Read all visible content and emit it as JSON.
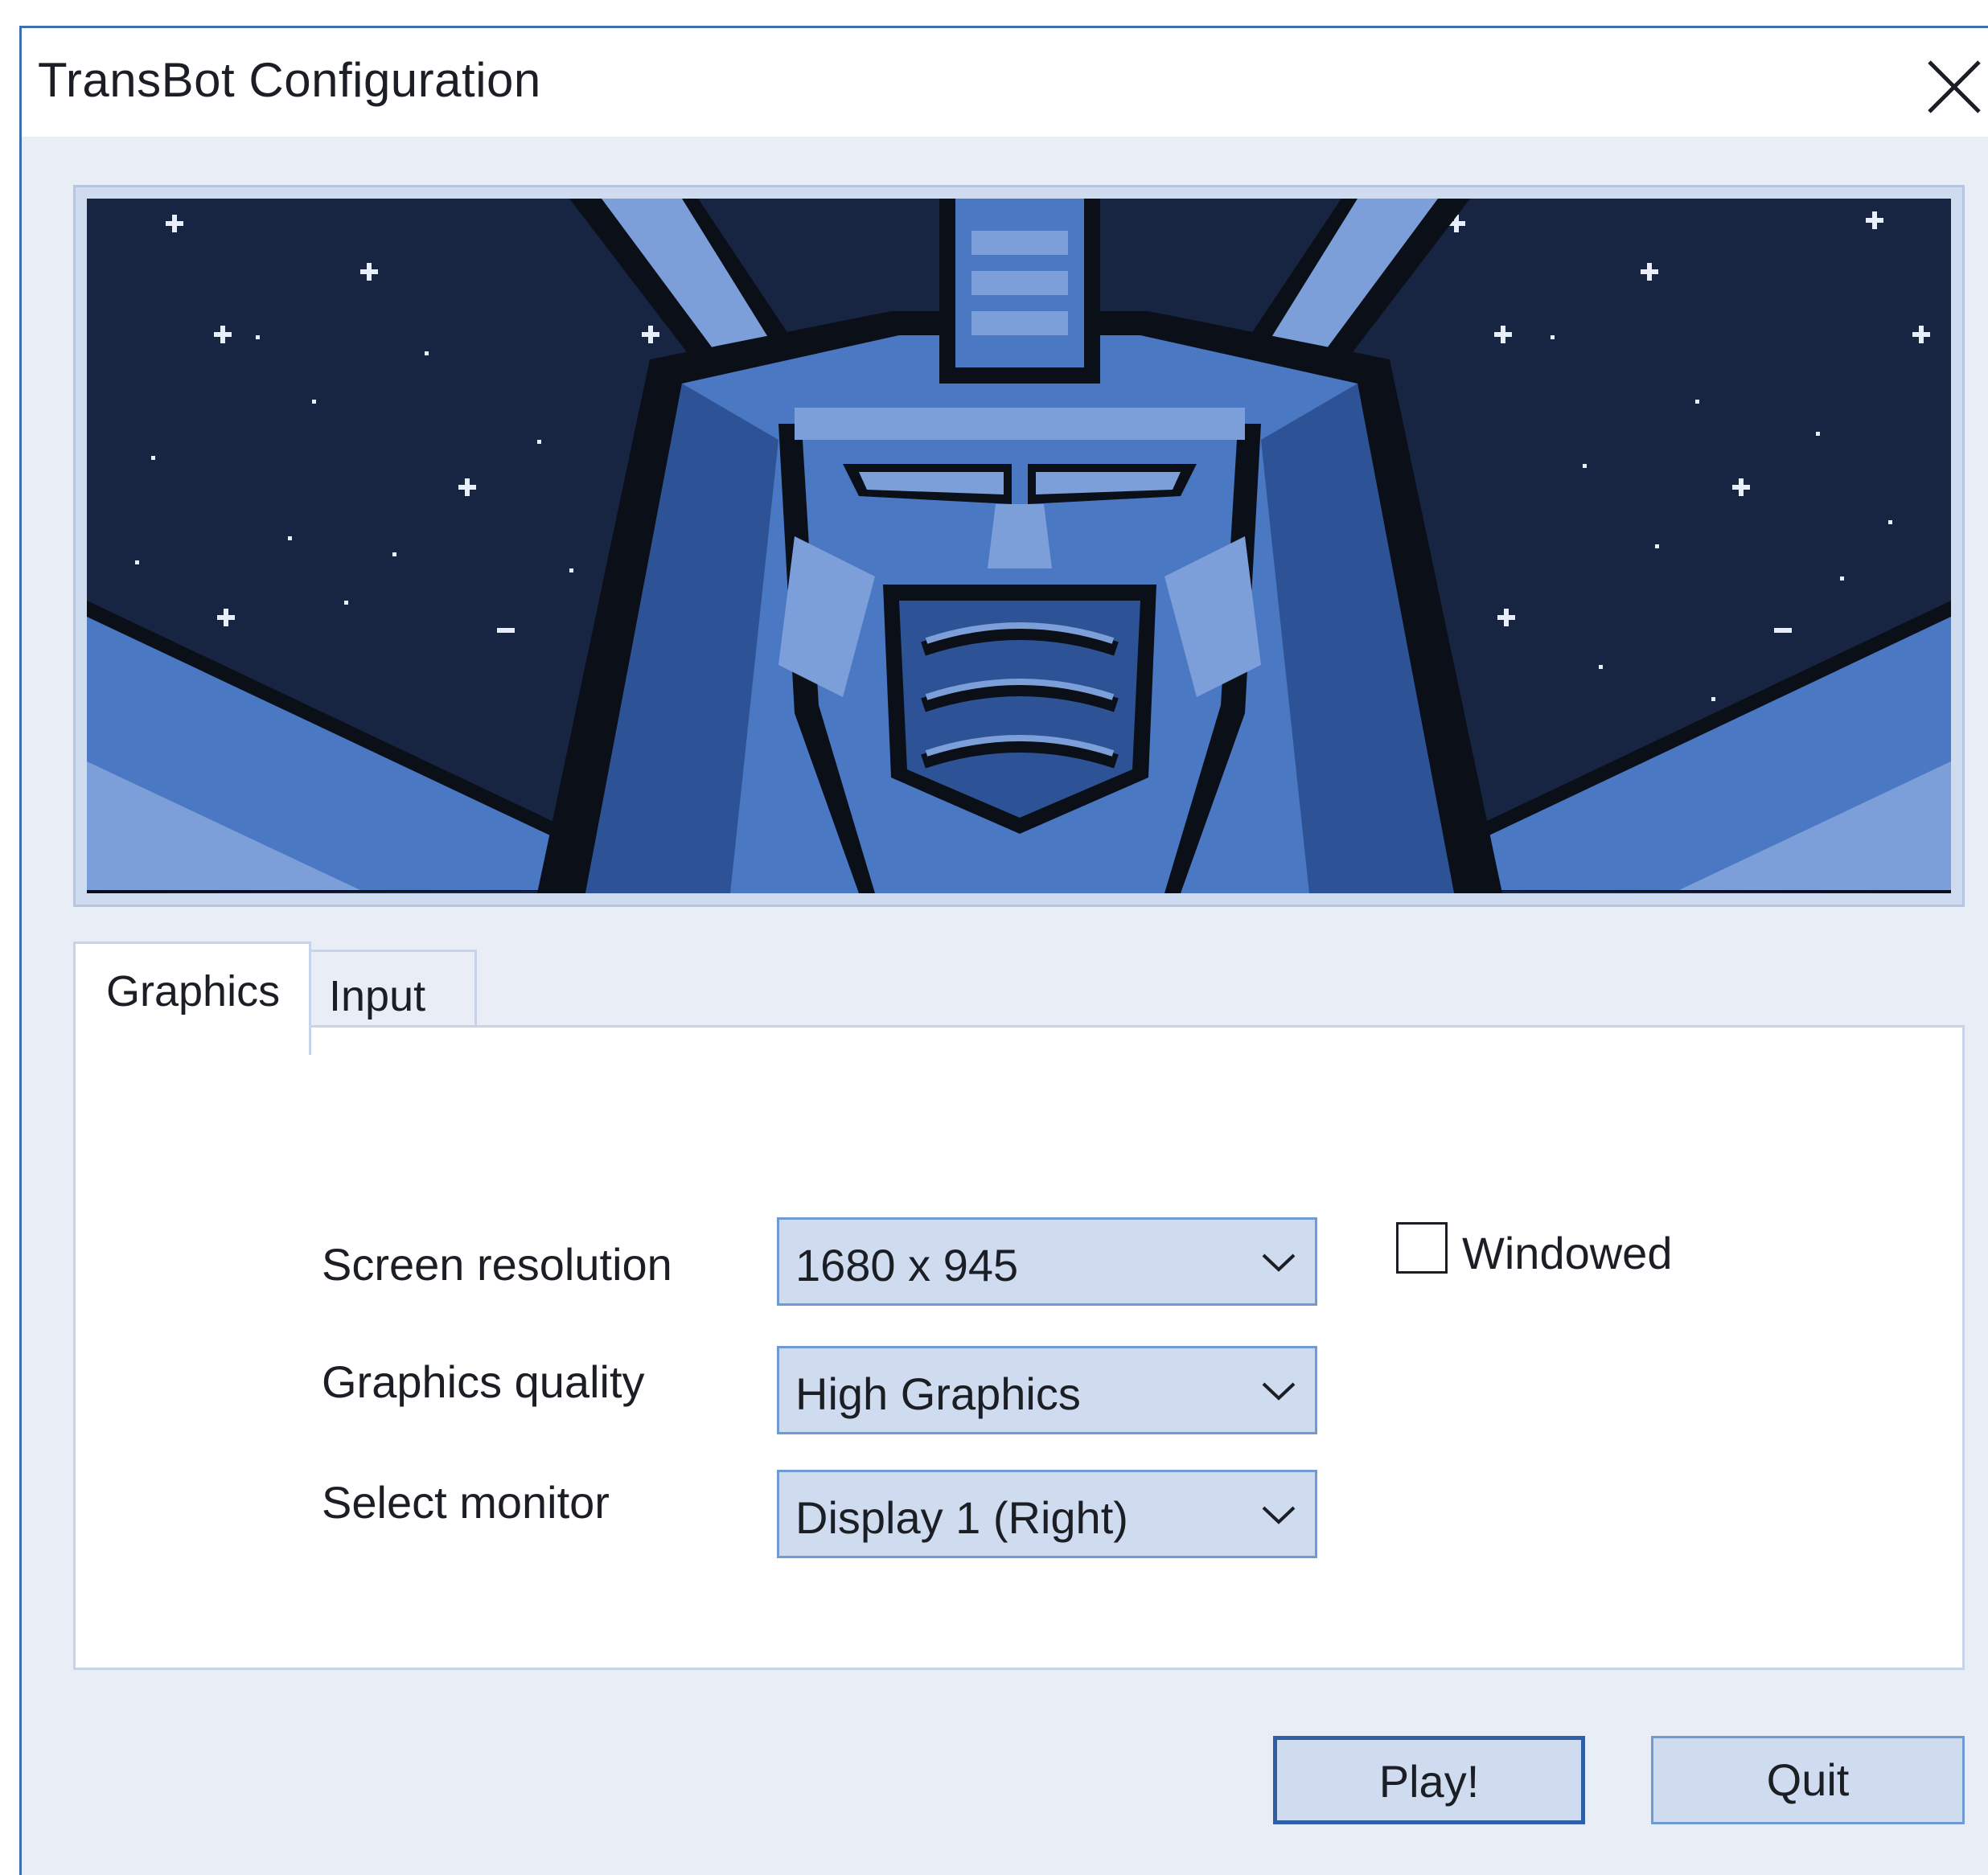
{
  "window": {
    "title": "TransBot Configuration"
  },
  "tabs": [
    {
      "label": "Graphics",
      "active": true
    },
    {
      "label": "Input",
      "active": false
    }
  ],
  "graphics": {
    "screen_resolution": {
      "label": "Screen resolution",
      "value": "1680 x 945"
    },
    "graphics_quality": {
      "label": "Graphics quality",
      "value": "High Graphics"
    },
    "select_monitor": {
      "label": "Select monitor",
      "value": "Display 1 (Right)"
    },
    "windowed": {
      "label": "Windowed",
      "checked": false
    }
  },
  "buttons": {
    "play": "Play!",
    "quit": "Quit"
  },
  "colors": {
    "accent": "#3f6fb0",
    "dialog_bg": "#e8edf6",
    "control_bg": "#cfdbef",
    "banner_sky": "#172542"
  },
  "icons": {
    "close": "close-icon",
    "dropdown": "chevron-down-icon"
  }
}
